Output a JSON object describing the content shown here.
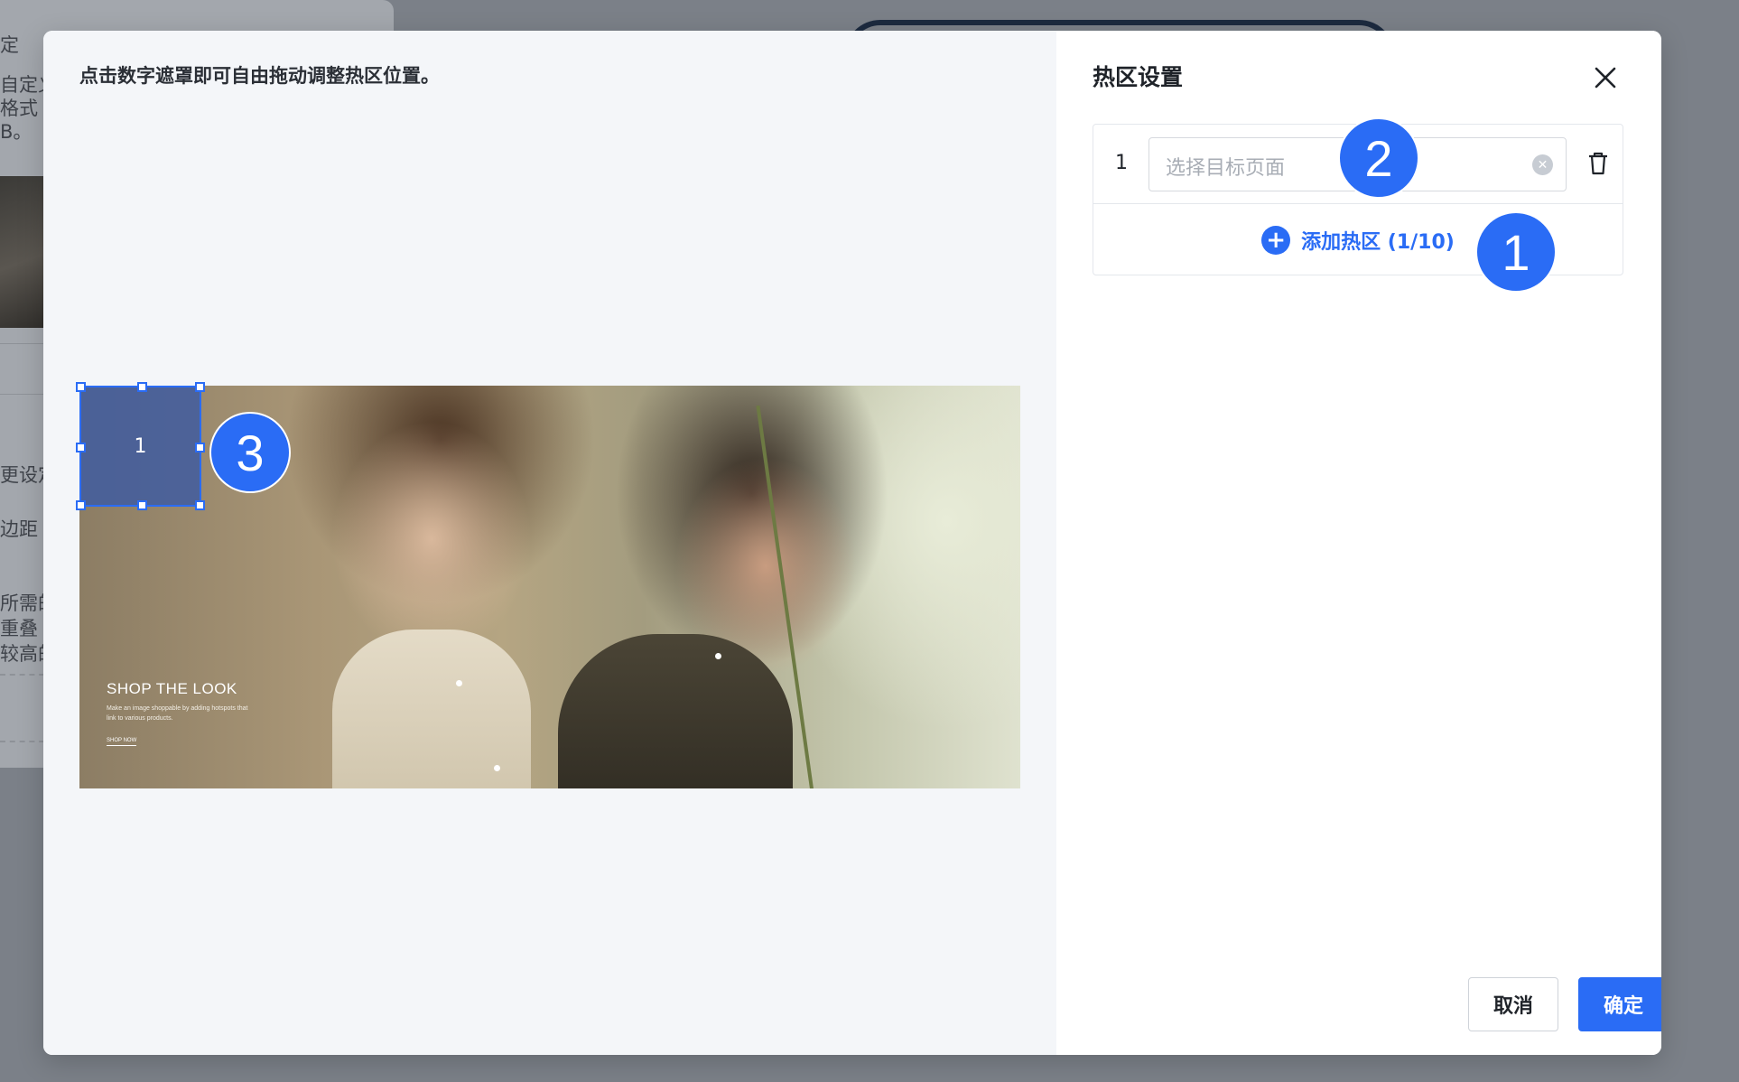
{
  "background": {
    "lines": [
      "定",
      "自定义",
      "格式",
      "B。",
      "更设定",
      "边距",
      "所需的",
      "重叠",
      "较高的"
    ]
  },
  "modal": {
    "hint": "点击数字遮罩即可自由拖动调整热区位置。",
    "banner": {
      "title": "SHOP THE LOOK",
      "body": "Make an image shoppable by adding hotspots that link to various products.",
      "link": "SHOP NOW"
    },
    "hotspot_label": "1",
    "panel_title": "热区设置",
    "rows": [
      {
        "index": "1",
        "placeholder": "选择目标页面"
      }
    ],
    "add_label": "添加热区 (1/10)",
    "cancel_label": "取消",
    "ok_label": "确定"
  },
  "markers": [
    "1",
    "2",
    "3"
  ],
  "colors": {
    "accent": "#2a6cf5",
    "hotspot_fill": "#405ca0"
  },
  "icons": [
    "close-icon",
    "clear-icon",
    "trash-icon",
    "plus-circle-icon"
  ]
}
